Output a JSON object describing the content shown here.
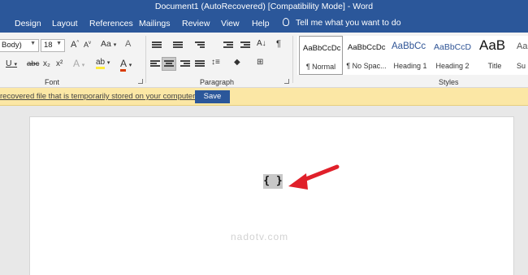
{
  "window": {
    "title": "Document1 (AutoRecovered) [Compatibility Mode]  -  Word"
  },
  "menu": {
    "tabs": [
      "Design",
      "Layout",
      "References",
      "Mailings",
      "Review",
      "View",
      "Help"
    ],
    "tell_me": "Tell me what you want to do"
  },
  "ribbon": {
    "font": {
      "name_value": "Body)",
      "size_value": "18",
      "grow_label": "A",
      "shrink_label": "A",
      "case_label": "Aa",
      "clear_label": "A",
      "underline_label": "U",
      "strike_label": "abc",
      "subscript_label": "x₂",
      "superscript_label": "x²",
      "effects_label": "A",
      "highlight_label": "ab",
      "color_label": "A",
      "group_label": "Font",
      "accent_color": "#d83b01",
      "highlight_color": "#ffeb3b"
    },
    "paragraph": {
      "group_label": "Paragraph",
      "pilcrow": "¶"
    },
    "styles": {
      "group_label": "Styles",
      "items": [
        {
          "sample": "AaBbCcDc",
          "name": "¶ Normal"
        },
        {
          "sample": "AaBbCcDc",
          "name": "¶ No Spac..."
        },
        {
          "sample": "AaBbCc",
          "name": "Heading 1"
        },
        {
          "sample": "AaBbCcD",
          "name": "Heading 2"
        },
        {
          "sample": "AaB",
          "name": "Title"
        },
        {
          "sample": "Aa",
          "name": "Su"
        }
      ]
    }
  },
  "infobar": {
    "message": "recovered file that is temporarily stored on your computer.",
    "save_label": "Save"
  },
  "document": {
    "field_code": "{ }",
    "watermark": "nadotv.com",
    "arrow_color": "#e0202a"
  },
  "colors": {
    "brand": "#2b579a",
    "infobar": "#fbe7a5"
  }
}
